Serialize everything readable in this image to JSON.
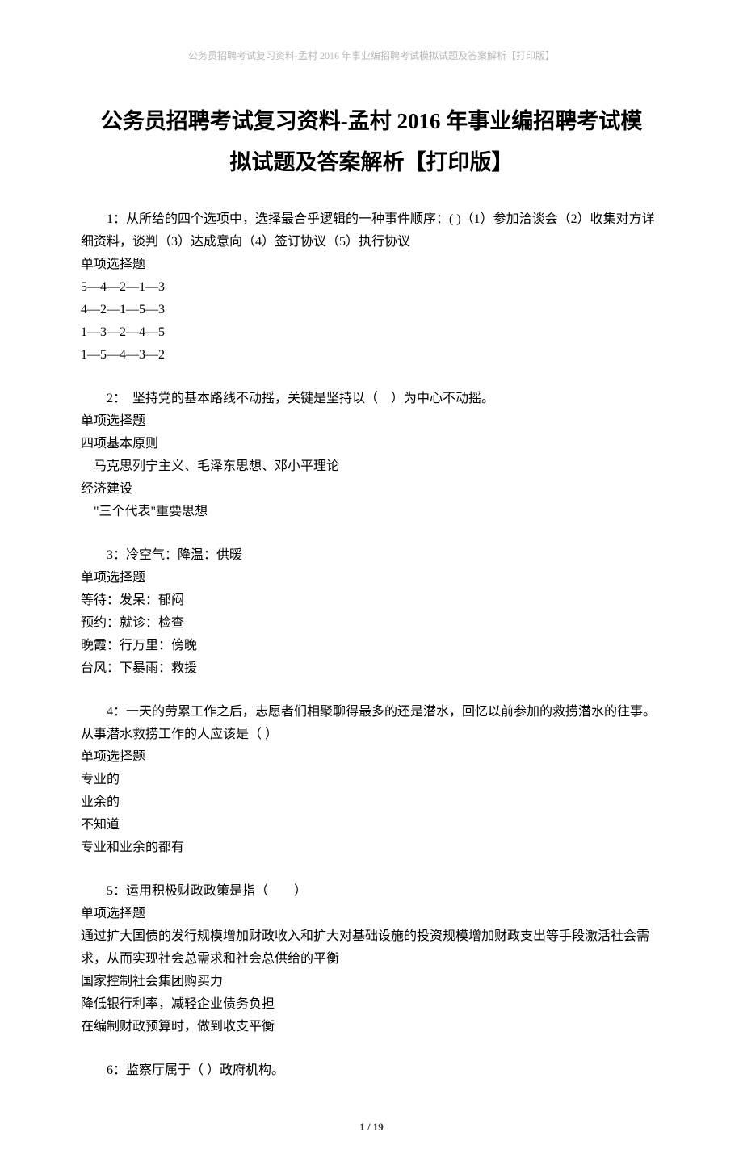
{
  "header": "公务员招聘考试复习资料-孟村 2016 年事业编招聘考试模拟试题及答案解析【打印版】",
  "title_line1": "公务员招聘考试复习资料-孟村 2016 年事业编招聘考试模",
  "title_line2": "拟试题及答案解析【打印版】",
  "questions": [
    {
      "stem": "1：从所给的四个选项中，选择最合乎逻辑的一种事件顺序：( )（1）参加洽谈会（2）收集对方详细资料，谈判（3）达成意向（4）签订协议（5）执行协议",
      "type": "单项选择题",
      "options": [
        "5—4—2—1—3",
        "4—2—1—5—3",
        "1—3—2—4—5",
        "1—5—4—3—2"
      ]
    },
    {
      "stem": "2：　坚持党的基本路线不动摇，关键是坚持以（　）为中心不动摇。",
      "type": "单项选择题",
      "options": [
        "四项基本原则",
        "　马克思列宁主义、毛泽东思想、邓小平理论",
        "经济建设",
        "　\"三个代表\"重要思想"
      ]
    },
    {
      "stem": "3：冷空气：降温：供暖",
      "type": "单项选择题",
      "options": [
        "等待：发呆：郁闷",
        "预约：就诊：检查",
        "晚霞：行万里：傍晚",
        "台风：下暴雨：救援"
      ]
    },
    {
      "stem": "4：一天的劳累工作之后，志愿者们相聚聊得最多的还是潜水，回忆以前参加的救捞潜水的往事。　　从事潜水救捞工作的人应该是（ ）",
      "type": "单项选择题",
      "options": [
        "专业的",
        "业余的",
        "不知道",
        "专业和业余的都有"
      ]
    },
    {
      "stem": "5：运用积极财政政策是指（　　）",
      "type": "单项选择题",
      "options": [
        "通过扩大国债的发行规模增加财政收入和扩大对基础设施的投资规模增加财政支出等手段激活社会需求，从而实现社会总需求和社会总供给的平衡",
        "国家控制社会集团购买力",
        "降低银行利率，减轻企业债务负担",
        "在编制财政预算时，做到收支平衡"
      ]
    },
    {
      "stem": "6：监察厅属于（ ）政府机构。",
      "type": "",
      "options": []
    }
  ],
  "footer": "1 / 19"
}
